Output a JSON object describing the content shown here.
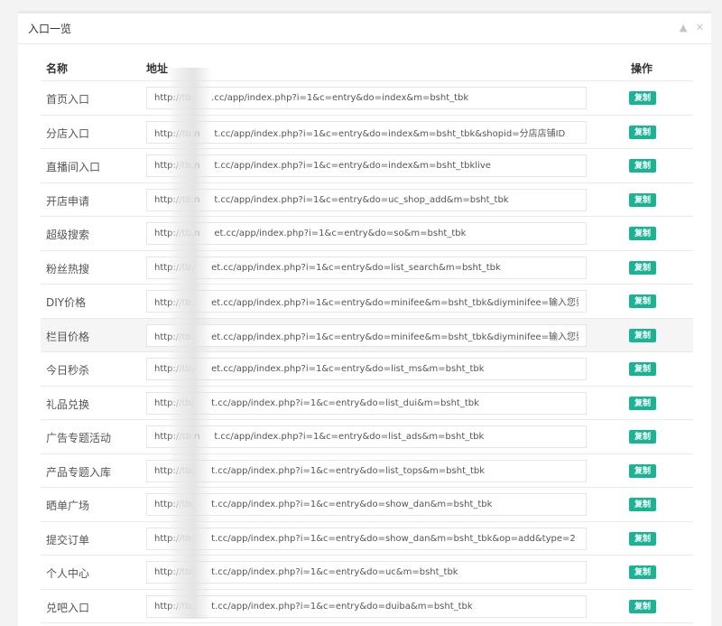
{
  "panel": {
    "title": "入口一览",
    "tools": {
      "collapse_icon": "chevron-up-icon",
      "close_icon": "close-icon"
    }
  },
  "table": {
    "headers": {
      "name": "名称",
      "url": "地址",
      "action": "操作"
    },
    "copy_label": "复制",
    "rows": [
      {
        "name": "首页入口",
        "url": "http://tb.      .cc/app/index.php?i=1&c=entry&do=index&m=bsht_tbk"
      },
      {
        "name": "分店入口",
        "url": "http://tb.n     t.cc/app/index.php?i=1&c=entry&do=index&m=bsht_tbk&shopid=分店店铺ID"
      },
      {
        "name": "直播间入口",
        "url": "http://tb.n     t.cc/app/index.php?i=1&c=entry&do=index&m=bsht_tbklive"
      },
      {
        "name": "开店申请",
        "url": "http://tb.n     t.cc/app/index.php?i=1&c=entry&do=uc_shop_add&m=bsht_tbk"
      },
      {
        "name": "超级搜索",
        "url": "http://tb.n     et.cc/app/index.php?i=1&c=entry&do=so&m=bsht_tbk"
      },
      {
        "name": "粉丝热搜",
        "url": "http://tb.      et.cc/app/index.php?i=1&c=entry&do=list_search&m=bsht_tbk"
      },
      {
        "name": "DIY价格",
        "url": "http://tb.      et.cc/app/index.php?i=1&c=entry&do=minifee&m=bsht_tbk&diyminifee=输入您要的数值"
      },
      {
        "name": "栏目价格",
        "url": "http://tb.      et.cc/app/index.php?i=1&c=entry&do=minifee&m=bsht_tbk&diyminifee=输入您要的数值&c"
      },
      {
        "name": "今日秒杀",
        "url": "http://tb.      et.cc/app/index.php?i=1&c=entry&do=list_ms&m=bsht_tbk"
      },
      {
        "name": "礼品兑换",
        "url": "http://tb.      t.cc/app/index.php?i=1&c=entry&do=list_dui&m=bsht_tbk"
      },
      {
        "name": "广告专题活动",
        "url": "http://tb.n     t.cc/app/index.php?i=1&c=entry&do=list_ads&m=bsht_tbk"
      },
      {
        "name": "产品专题入库",
        "url": "http://tb.      t.cc/app/index.php?i=1&c=entry&do=list_tops&m=bsht_tbk"
      },
      {
        "name": "晒单广场",
        "url": "http://tb.      t.cc/app/index.php?i=1&c=entry&do=show_dan&m=bsht_tbk"
      },
      {
        "name": "提交订单",
        "url": "http://tb.      t.cc/app/index.php?i=1&c=entry&do=show_dan&m=bsht_tbk&op=add&type=2"
      },
      {
        "name": "个人中心",
        "url": "http://tb.      t.cc/app/index.php?i=1&c=entry&do=uc&m=bsht_tbk"
      },
      {
        "name": "兑吧入口",
        "url": "http://tb.      t.cc/app/index.php?i=1&c=entry&do=duiba&m=bsht_tbk"
      }
    ]
  },
  "colors": {
    "accent": "#1ab394",
    "highlight_row": "#f5f5f5"
  }
}
